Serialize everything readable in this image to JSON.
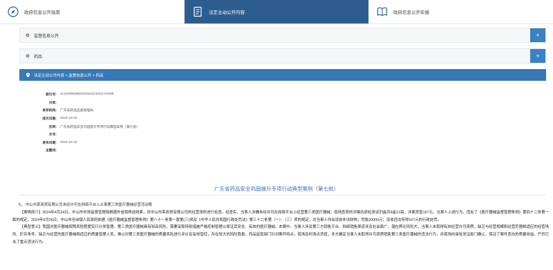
{
  "nav": {
    "tabs": [
      {
        "label": "政府信息公开指南",
        "icon": "compass-icon",
        "active": false
      },
      {
        "label": "法定主动公开内容",
        "icon": "document-icon",
        "active": true
      },
      {
        "label": "政府信息公开年报",
        "icon": "book-icon",
        "active": false
      }
    ]
  },
  "accordion": [
    {
      "label": "监督信息公开",
      "toggle": "+"
    },
    {
      "label": "药品",
      "toggle": "+"
    }
  ],
  "breadcrumb": "法定主动公开内容 > 监督信息公开 > 药品",
  "meta": {
    "rows": [
      {
        "key": "索引号:",
        "value": "11440000MB2D034421/2024-01098"
      },
      {
        "key": "分类:",
        "value": ""
      },
      {
        "key": "发布机构:",
        "value": "广东省药品监督管理局"
      },
      {
        "key": "成文日期:",
        "value": "2024-10-22"
      },
      {
        "key": "名称:",
        "value": "广东省药品安全巩固提升专项行动典型案例（第七批）"
      },
      {
        "key": "文号:",
        "value": ""
      },
      {
        "key": "发布日期:",
        "value": "2024-10-22"
      },
      {
        "key": "主题词:",
        "value": ""
      }
    ]
  },
  "doc_title": "广东省药品安全巩固提升专项行动典型案例（第七批）",
  "article": {
    "heading": "七、中山市某商贸有限公司未经许可在网络平台上从事第三类医疗器械经营活动案",
    "para1": "【案情简介】2024年4月24日，中山市市场监督管理局根据外省局移送线索，对中山市某商贸有限公司的经营场所进行检查。经查实，当事人涉嫌未经许可在网络平台上经营第三类医疗器械，现场查获的涉案抗原检测试剂盒共9盒12袋，涉案货值167元。当事人上述行为，违反了《医疗器械监督管理条例》第四十二条第一款的规定，2024年6月26日，中山市坦洲镇人民政府依据《医疗器械监督管理条例》第八十一条第一款第(三)项及《中华人民共和国行政处罚法》第三十二条第（一）、（三）项的规定，对当事人作出没收非法财物；罚款20000元；没收违法所得167元的行政处罚。",
    "para2": "【典型意义】我国对医疗器械按照风险程度实行分类管理。第三类医疗器械具有较高风险，需要采取特别措施严格控制管理以保证其安全、有效的医疗器械。本案中，当事人涉及第三方销售平台、网络销售渠道涉及社会面广，潜在舆论风险大，当事人未取得有效经营许可资质，缺乏与经营规模和经营范围相适应的经营场所、贮存条件，缺乏与经营的医疗器械相适应的质量管理人员，难以对第三类医疗器械的质量风险进行评价及有效管控，存在较大的风险隐患。药品监管部门针对案件特点，现场及时清点货值，多方确定当事人未取得许可资质销售第三类医疗器械的违法行为，并现场向审批发证部门确认，保证了案件查办的质量效益，严厉打击了重点违法行为。"
  },
  "colors": {
    "nav_active": "#2d5d8f",
    "accent_blue": "#3978b6",
    "plus_button": "#3a80c3",
    "title_blue": "#3a6fb0"
  }
}
